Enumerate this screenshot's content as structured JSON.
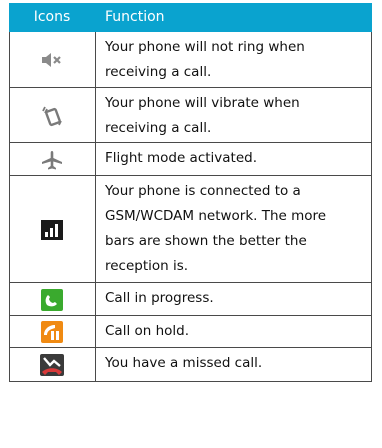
{
  "header": {
    "icons": "Icons",
    "function": "Function"
  },
  "colors": {
    "header_bg": "#0aa3cf",
    "call_green": "#3aaa2e",
    "hold_orange": "#f08a12",
    "missed_red": "#d83a3a"
  },
  "rows": [
    {
      "icon": "mute-icon",
      "lines": [
        "Your phone will not ring when",
        "receiving a call."
      ]
    },
    {
      "icon": "vibrate-icon",
      "lines": [
        "Your phone will vibrate when",
        "receiving a call."
      ]
    },
    {
      "icon": "airplane-icon",
      "lines": [
        "Flight mode activated."
      ]
    },
    {
      "icon": "signal-icon",
      "lines": [
        "Your phone is connected to a",
        "GSM/WCDAM network. The more",
        "bars are shown the better the",
        "reception is."
      ]
    },
    {
      "icon": "call-in-progress-icon",
      "lines": [
        "Call in progress."
      ]
    },
    {
      "icon": "call-on-hold-icon",
      "lines": [
        "Call on hold."
      ]
    },
    {
      "icon": "missed-call-icon",
      "lines": [
        "You have a missed call."
      ]
    }
  ]
}
